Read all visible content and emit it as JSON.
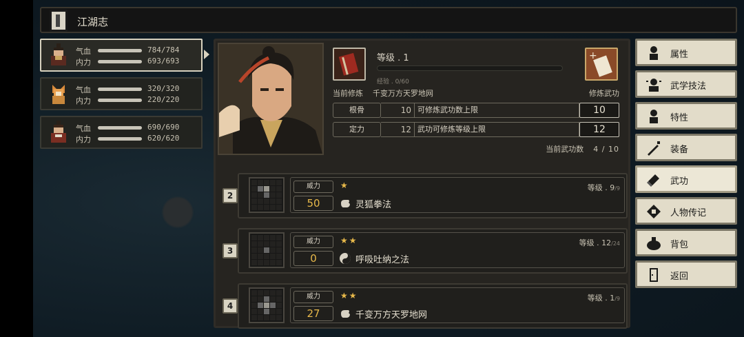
{
  "titlebar": {
    "title": "江湖志"
  },
  "party": [
    {
      "hp_label": "气血",
      "hp": "784/784",
      "mp_label": "内力",
      "mp": "693/693"
    },
    {
      "hp_label": "气血",
      "hp": "320/320",
      "mp_label": "内力",
      "mp": "220/220"
    },
    {
      "hp_label": "气血",
      "hp": "690/690",
      "mp_label": "内力",
      "mp": "620/620"
    }
  ],
  "info": {
    "level_label": "等级 . 1",
    "exp_text": "经验 . 0/60",
    "current_practice_label": "当前修炼",
    "current_practice_value": "千变万方天罗地网",
    "practice_button_label": "修炼武功",
    "attributes": [
      {
        "name": "根骨",
        "value": "10",
        "desc": "可修炼武功数上限",
        "result": "10"
      },
      {
        "name": "定力",
        "value": "12",
        "desc": "武功可修炼等级上限",
        "result": "12"
      }
    ],
    "count_label": "当前武功数",
    "count_value": "4 / 10"
  },
  "skills": [
    {
      "index": "2",
      "power_label": "威力",
      "power": "50",
      "stars": "★",
      "level": "等级 . 9",
      "level_max": "/9",
      "name": "灵狐拳法",
      "icon": "fist-icon"
    },
    {
      "index": "3",
      "power_label": "威力",
      "power": "0",
      "stars": "★★",
      "level": "等级 . 12",
      "level_max": "/24",
      "name": "呼吸吐纳之法",
      "icon": "yin-yang-icon"
    },
    {
      "index": "4",
      "power_label": "威力",
      "power": "27",
      "stars": "★★",
      "level": "等级 . 1",
      "level_max": "/9",
      "name": "千变万方天罗地网",
      "icon": "fist-icon"
    }
  ],
  "menu": [
    {
      "label": "属性",
      "icon": "person-icon"
    },
    {
      "label": "武学技法",
      "icon": "person-burst-icon"
    },
    {
      "label": "特性",
      "icon": "person-icon"
    },
    {
      "label": "装备",
      "icon": "sword-icon"
    },
    {
      "label": "武功",
      "icon": "book-icon"
    },
    {
      "label": "人物传记",
      "icon": "scroll-icon"
    },
    {
      "label": "背包",
      "icon": "bag-icon"
    },
    {
      "label": "返回",
      "icon": "door-icon"
    }
  ],
  "colors": {
    "accent_gold": "#e7b84a",
    "menu_bg": "#e2dcc9",
    "panel_bg": "#262420"
  }
}
